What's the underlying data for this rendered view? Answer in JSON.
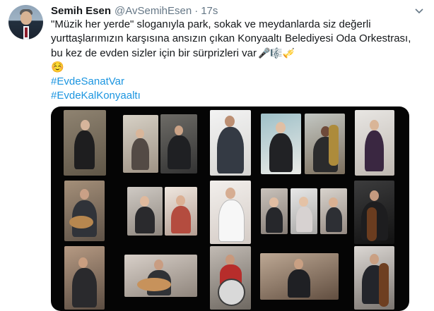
{
  "tweet": {
    "author_name": "Semih Esen",
    "author_handle": "@AvSemihEsen",
    "separator": "·",
    "timestamp": "17s",
    "text_lines": [
      "\"Müzik her yerde\" sloganıyla park, sokak ve meydanlarda siz değerli",
      "yurttaşlarımızın karşısına ansızın çıkan Konyaaltı Belediyesi Oda Orkestrası,",
      "bu kez de evden sizler için bir sürprizleri var"
    ],
    "emoji_after_text": [
      "🎤",
      "🎼",
      "🎺"
    ],
    "emoji_line": "☺️",
    "hashtags": [
      "#EvdeSanatVar",
      "#EvdeKalKonyaaltı"
    ],
    "colors": {
      "link": "#1b95e0",
      "secondary_text": "#657786",
      "media_background": "#050505"
    },
    "icons": [
      "avatar",
      "chevron-down-icon"
    ]
  }
}
